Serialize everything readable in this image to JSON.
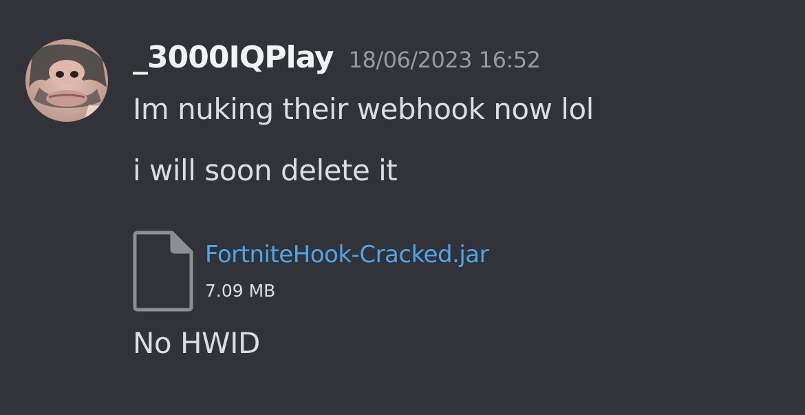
{
  "message": {
    "author": {
      "username": "_3000IQPlay",
      "avatar_icon": "avatar-image"
    },
    "timestamp": "18/06/2023 16:52",
    "lines": [
      "Im nuking their webhook now lol",
      "i will soon delete it",
      "No HWID"
    ],
    "attachment": {
      "icon": "file-icon",
      "file_name": "FortniteHook-Cracked.jar",
      "file_size": "7.09 MB"
    }
  },
  "colors": {
    "background": "#313338",
    "username": "#f2f3f5",
    "timestamp": "#949ba4",
    "text": "#dbdee1",
    "link": "#4ea6ea",
    "file_icon": "#8a8e95"
  }
}
